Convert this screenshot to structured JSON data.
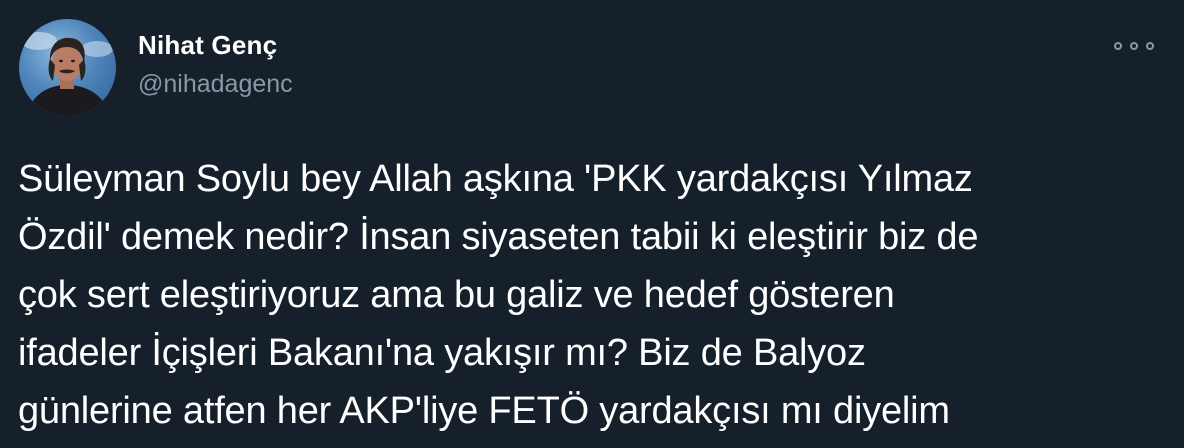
{
  "author": {
    "name": "Nihat Genç",
    "handle": "@nihadagenc",
    "avatar_icon": "profile-photo"
  },
  "menu": {
    "icon": "more-options-icon"
  },
  "tweet": {
    "text": "Süleyman Soylu bey Allah aşkına 'PKK yardakçısı Yılmaz\nÖzdil' demek nedir? İnsan siyaseten tabii ki eleştirir biz de\nçok sert eleştiriyoruz ama bu galiz ve hedef gösteren\nifadeler İçişleri Bakanı'na yakışır mı? Biz de Balyoz\ngünlerine atfen her AKP'liye FETÖ yardakçısı mı diyelim"
  },
  "colors": {
    "background": "#15202b",
    "text_primary": "#ffffff",
    "text_secondary": "#8899a6"
  }
}
